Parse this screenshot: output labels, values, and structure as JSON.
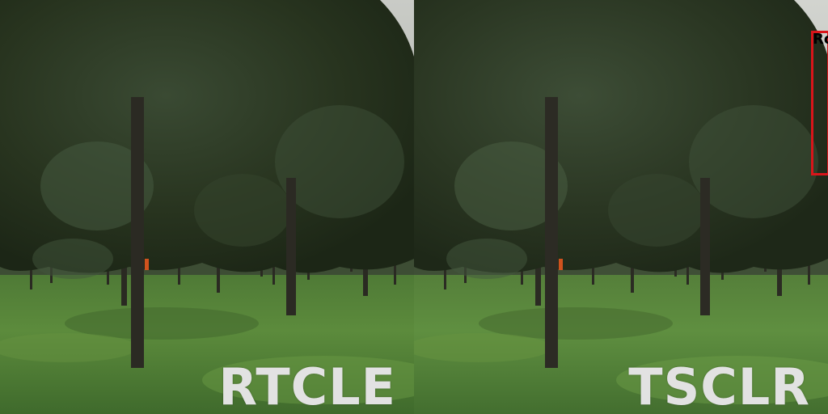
{
  "panels": [
    {
      "label": "RTCLE"
    },
    {
      "label": "TSCLR"
    }
  ],
  "detection": {
    "label": "Ro",
    "box_color": "#d9151a"
  }
}
